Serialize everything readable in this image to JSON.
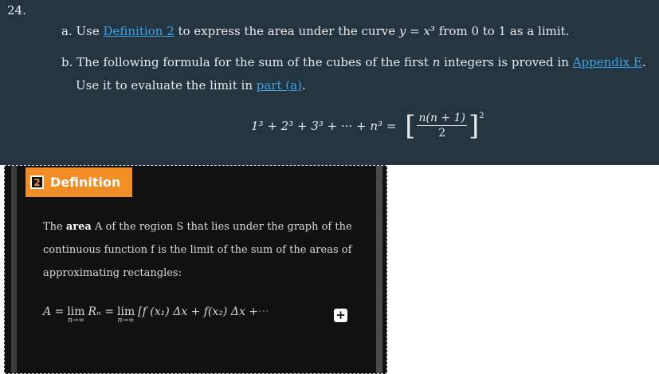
{
  "problem": {
    "number": "24.",
    "part_a": {
      "prefix": "a. Use ",
      "link": "Definition 2",
      "middle": " to express the area under the curve ",
      "curve": "y = x³",
      "suffix_1": " from ",
      "from": "0",
      "to_text": " to ",
      "to": "1",
      "suffix_2": " as a limit."
    },
    "part_b": {
      "line1_prefix": "b. The following formula for the sum of the cubes of the first ",
      "n": "n",
      "line1_middle": " integers is proved in ",
      "link": "Appendix E",
      "line1_suffix": ".",
      "line2_prefix": "Use it to evaluate the limit in ",
      "line2_link": "part (a)",
      "line2_suffix": "."
    },
    "formula": {
      "lhs": "1³ + 2³ + 3³ + ··· + n³ =",
      "numerator": "n(n + 1)",
      "denominator": "2",
      "exponent": "2"
    }
  },
  "popup": {
    "number": "2",
    "title": "Definition",
    "text_1": "The ",
    "bold": "area",
    "text_2": " A of the region S that lies under the graph of the continuous function f is the limit of the sum of the areas of approximating rectangles:",
    "formula_lhs": "A =",
    "lim_1": "lim",
    "lim_1_sub": "n→∞",
    "formula_mid": "Rₙ =",
    "lim_2": "lim",
    "lim_2_sub": "n→∞",
    "formula_rhs": "[f (x₁) Δx + f(x₂) Δx + ",
    "formula_fade": "···",
    "expand": "+"
  }
}
